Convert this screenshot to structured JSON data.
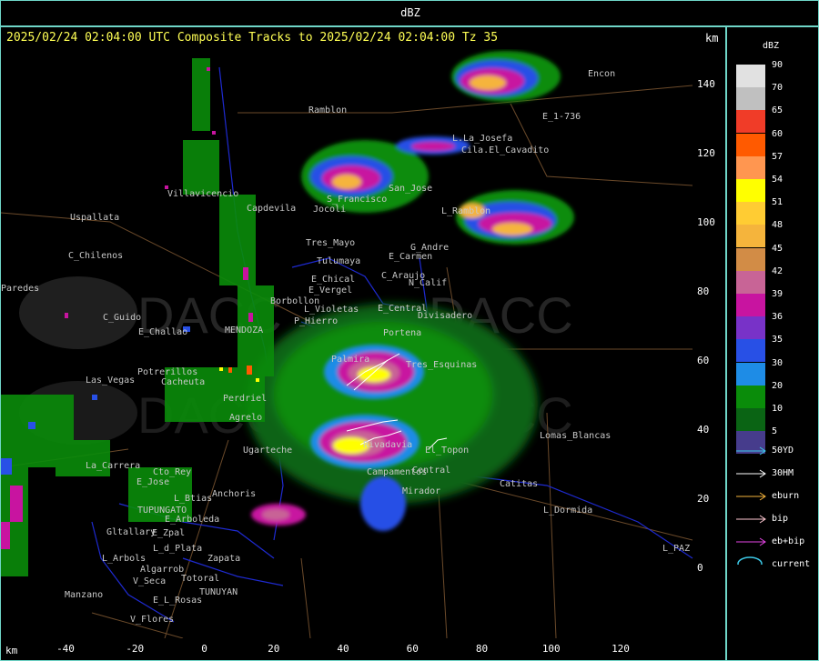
{
  "top_title": "dBZ",
  "header": "2025/02/24 02:04:00 UTC Composite Tracks to 2025/02/24 02:04:00 Tz 35",
  "km_label": "km",
  "axis": {
    "x_ticks": [
      "-40",
      "-20",
      "0",
      "20",
      "40",
      "60",
      "80",
      "100",
      "120"
    ],
    "y_ticks": [
      "140",
      "120",
      "100",
      "80",
      "60",
      "40",
      "20",
      "0"
    ]
  },
  "legend": {
    "title": "dBZ",
    "levels": [
      {
        "label": "90",
        "color": "#e1e1e1"
      },
      {
        "label": "70",
        "color": "#c0c0c0"
      },
      {
        "label": "65",
        "color": "#f03c28"
      },
      {
        "label": "60",
        "color": "#ff5a00"
      },
      {
        "label": "57",
        "color": "#ff9650"
      },
      {
        "label": "54",
        "color": "#ffff00"
      },
      {
        "label": "51",
        "color": "#ffcc33"
      },
      {
        "label": "48",
        "color": "#f5b43c"
      },
      {
        "label": "45",
        "color": "#d28c46"
      },
      {
        "label": "42",
        "color": "#c86496"
      },
      {
        "label": "39",
        "color": "#c814a0"
      },
      {
        "label": "36",
        "color": "#7832c8"
      },
      {
        "label": "35",
        "color": "#2850e6"
      },
      {
        "label": "30",
        "color": "#1e8ce6"
      },
      {
        "label": "20",
        "color": "#0a8c0a"
      },
      {
        "label": "10",
        "color": "#0a6414"
      },
      {
        "label": "5",
        "color": "#463c8c"
      }
    ],
    "tracks": [
      {
        "label": "50YD",
        "color": "#3cc8e6"
      },
      {
        "label": "30HM",
        "color": "#ffffff"
      },
      {
        "label": "eburn",
        "color": "#f5b43c"
      },
      {
        "label": "bip",
        "color": "#ffc8d2"
      },
      {
        "label": "eb+bip",
        "color": "#e646e6"
      },
      {
        "label": "current",
        "color": "#3cc8e6"
      }
    ]
  },
  "places": [
    {
      "name": "Encon"
    },
    {
      "name": "E_1-736"
    },
    {
      "name": "Ramblon"
    },
    {
      "name": "L.La_Josefa"
    },
    {
      "name": "Cila.El_Cavadito"
    },
    {
      "name": "Villavicencio"
    },
    {
      "name": "S_Francisco"
    },
    {
      "name": "San_Jose"
    },
    {
      "name": "Uspallata"
    },
    {
      "name": "Capdevila"
    },
    {
      "name": "Jocoli"
    },
    {
      "name": "L_Ramblon"
    },
    {
      "name": "Tres_Mayo"
    },
    {
      "name": "G_Andre"
    },
    {
      "name": "Tulumaya"
    },
    {
      "name": "E_Carmen"
    },
    {
      "name": "C_Chilenos"
    },
    {
      "name": "E_Chical"
    },
    {
      "name": "C_Araujo"
    },
    {
      "name": "N_Calif"
    },
    {
      "name": "E_Vergel"
    },
    {
      "name": "Borbollon"
    },
    {
      "name": "L_Violetas"
    },
    {
      "name": "E_Central"
    },
    {
      "name": "C_Guido"
    },
    {
      "name": "P_Hierro"
    },
    {
      "name": "Divisadero"
    },
    {
      "name": "E_Challao"
    },
    {
      "name": "MENDOZA"
    },
    {
      "name": "Portena"
    },
    {
      "name": "Potrerillos"
    },
    {
      "name": "Cacheuta"
    },
    {
      "name": "Las_Vegas"
    },
    {
      "name": "Palmira"
    },
    {
      "name": "Tres_Esquinas"
    },
    {
      "name": "Perdriel"
    },
    {
      "name": "Agrelo"
    },
    {
      "name": "Ugarteche"
    },
    {
      "name": "Rivadavia"
    },
    {
      "name": "Lomas_Blancas"
    },
    {
      "name": "La_Carrera"
    },
    {
      "name": "Cto_Rey"
    },
    {
      "name": "El_Topon"
    },
    {
      "name": "Campamentos"
    },
    {
      "name": "Central"
    },
    {
      "name": "E_Jose"
    },
    {
      "name": "L_Btias"
    },
    {
      "name": "Anchoris"
    },
    {
      "name": "TUPUNGATO"
    },
    {
      "name": "E_Arboleda"
    },
    {
      "name": "Mirador"
    },
    {
      "name": "L_Dormida"
    },
    {
      "name": "Catitas"
    },
    {
      "name": "Gltallary"
    },
    {
      "name": "E_Zpal"
    },
    {
      "name": "L_d_Plata"
    },
    {
      "name": "L_Arbols"
    },
    {
      "name": "Zapata"
    },
    {
      "name": "Algarrob"
    },
    {
      "name": "V_Seca"
    },
    {
      "name": "Totoral"
    },
    {
      "name": "TUNUYAN"
    },
    {
      "name": "E_L_Rosas"
    },
    {
      "name": "Manzano"
    },
    {
      "name": "V_Flores"
    },
    {
      "name": "L_PAZ"
    },
    {
      "name": "Paredes"
    }
  ]
}
